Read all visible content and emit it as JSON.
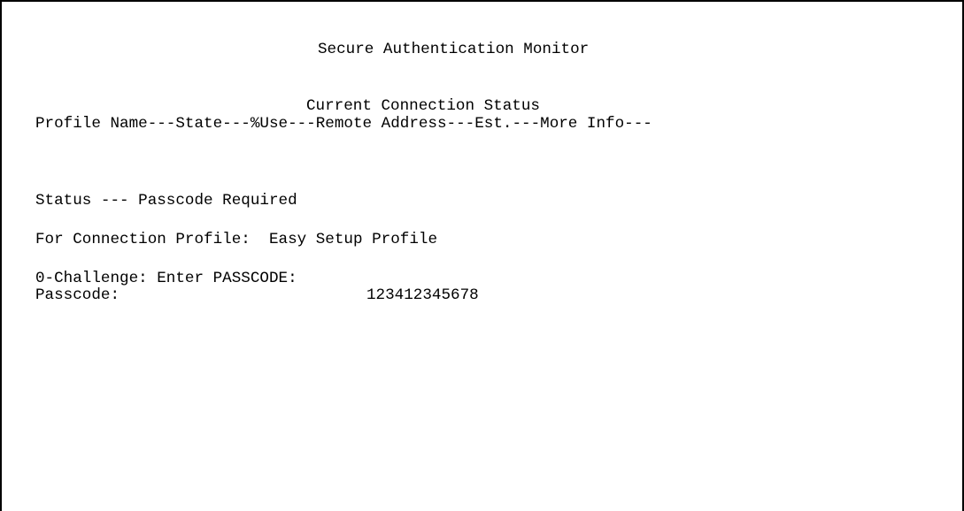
{
  "window": {
    "title": "Secure Authentication Monitor"
  },
  "connection_status": {
    "heading": "Current Connection Status",
    "column_header_line": "Profile Name---State---%Use---Remote Address---Est.---More Info---"
  },
  "status": {
    "line": "Status --- Passcode Required"
  },
  "profile": {
    "label": "For Connection Profile:  ",
    "value": "Easy Setup Profile"
  },
  "challenge": {
    "prompt": "0-Challenge: Enter PASSCODE:"
  },
  "passcode": {
    "label": "Passcode:",
    "value": "123412345678"
  }
}
